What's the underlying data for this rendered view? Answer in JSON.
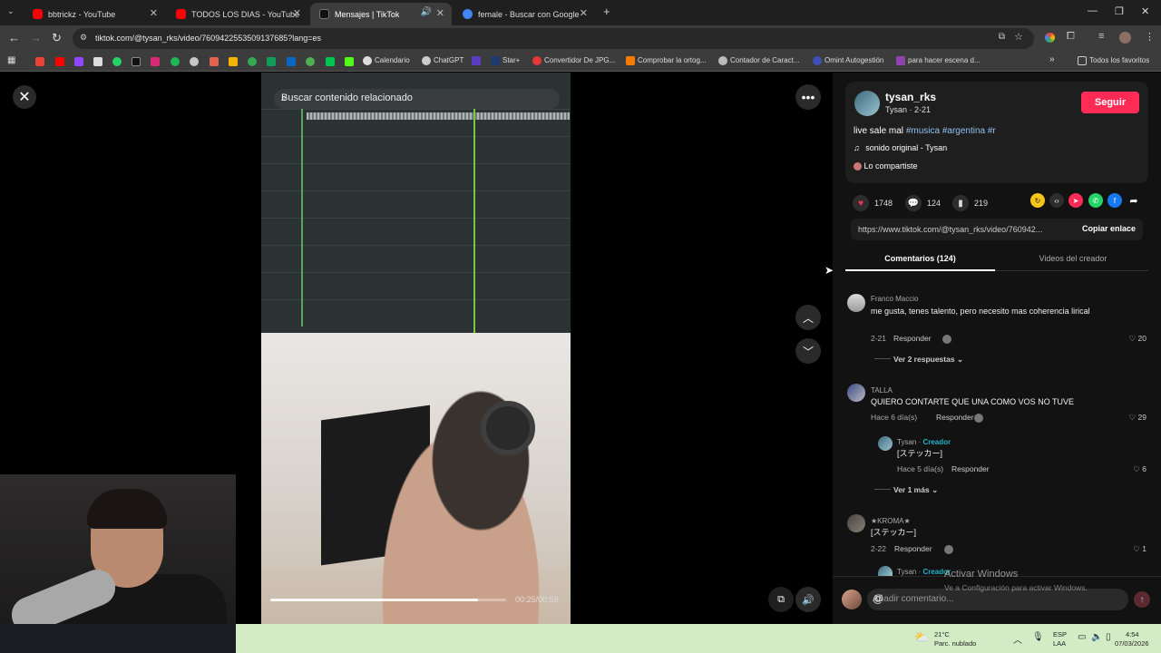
{
  "browser": {
    "tabs": [
      {
        "title": "bbtrickz - YouTube",
        "color": "#ff0000"
      },
      {
        "title": "TODOS LOS DIAS - YouTube",
        "color": "#ff0000"
      },
      {
        "title": "Mensajes | TikTok",
        "color": "#111111"
      },
      {
        "title": "female - Buscar con Google",
        "color": "#4285f4"
      }
    ],
    "url": "tiktok.com/@tysan_rks/video/7609422553509137685?lang=es",
    "bookmarks": [
      "Calendario",
      "ChatGPT",
      "Star+",
      "Convertidor De JPG...",
      "Comprobar la ortog...",
      "Contador de Caract...",
      "Omint Autogestión",
      "para hacer escena d...",
      "Todos los favoritos"
    ]
  },
  "video": {
    "search_placeholder": "Buscar contenido relacionado",
    "time": "00:25/00:59",
    "progress_fraction": 0.88
  },
  "post": {
    "username": "tysan_rks",
    "subtitle": "Tysan · 2-21",
    "follow_label": "Seguir",
    "caption_text": "live sale mal",
    "hashtags": "#musica #argentina #r",
    "sound": "sonido original - Tysan",
    "shared_by": "Lo compartiste",
    "likes": "1748",
    "comments": "124",
    "saves": "219",
    "link": "https://www.tiktok.com/@tysan_rks/video/760942...",
    "copy_label": "Copiar enlace",
    "tab_comments": "Comentarios (124)",
    "tab_videos": "Videos del creador"
  },
  "comments": [
    {
      "user": "Franco Maccio",
      "text": "me gusta, tenes talento, pero necesito mas coherencia lirical",
      "date": "2-21",
      "reply": "Responder",
      "likes": "20",
      "more": "Ver 2 respuestas"
    },
    {
      "user": "TALLA",
      "text": "QUIERO CONTARTE QUE UNA COMO VOS NO TUVE",
      "date": "Hace 6 día(s)",
      "reply": "Responder",
      "likes": "29"
    },
    {
      "user": "Tysan",
      "creator": "Creador",
      "text": "[ステッカー]",
      "date": "Hace 5 día(s)",
      "reply": "Responder",
      "likes": "6",
      "more": "Ver 1 más"
    },
    {
      "user": "★KROMA★",
      "text": "[ステッカー]",
      "date": "2-22",
      "reply": "Responder",
      "likes": "1"
    },
    {
      "user": "Tysan",
      "creator": "Creador"
    }
  ],
  "comment_input_placeholder": "Añadir comentario...",
  "windows_activation": {
    "title": "Activar Windows",
    "subtitle": "Ve a Configuración para activar Windows."
  },
  "taskbar": {
    "temp": "21°C",
    "weather": "Parc. nublado",
    "lang1": "ESP",
    "lang2": "LAA",
    "time": "4:54",
    "date": "07/03/2026"
  }
}
